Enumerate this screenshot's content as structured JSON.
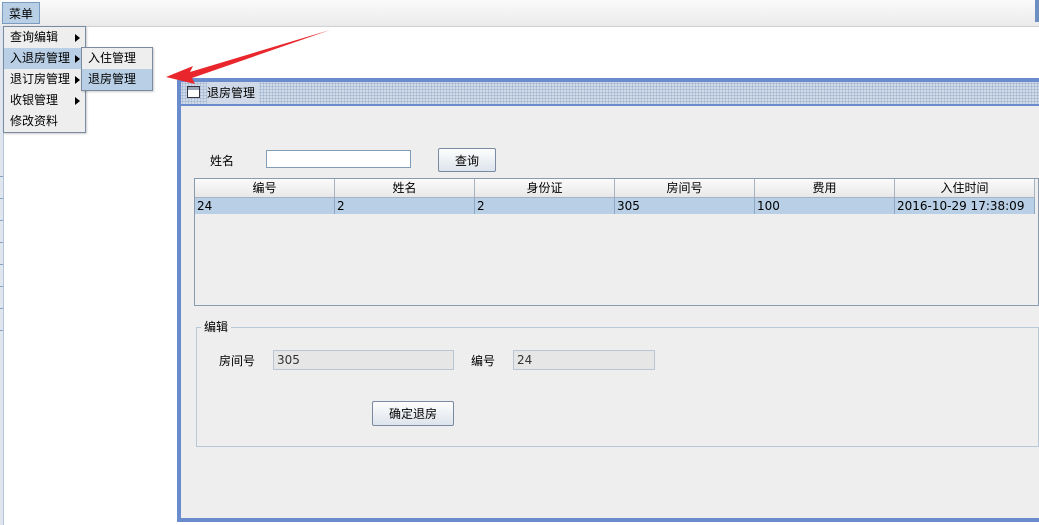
{
  "menubar": {
    "menu_title": "菜单"
  },
  "main_menu": {
    "items": [
      {
        "label": "查询编辑",
        "has_submenu": true
      },
      {
        "label": "入退房管理",
        "has_submenu": true
      },
      {
        "label": "退订房管理",
        "has_submenu": true
      },
      {
        "label": "收银管理",
        "has_submenu": true
      },
      {
        "label": "修改资料",
        "has_submenu": false
      }
    ]
  },
  "sub_menu": {
    "items": [
      {
        "label": "入住管理"
      },
      {
        "label": "退房管理"
      }
    ]
  },
  "window": {
    "title": "退房管理"
  },
  "search": {
    "name_label": "姓名",
    "name_value": "",
    "button_label": "查询"
  },
  "table": {
    "columns": [
      "编号",
      "姓名",
      "身份证",
      "房间号",
      "费用",
      "入住时间"
    ],
    "rows": [
      [
        "24",
        "2",
        "2",
        "305",
        "100",
        "2016-10-29 17:38:09"
      ]
    ]
  },
  "edit": {
    "group_title": "编辑",
    "room_label": "房间号",
    "room_value": "305",
    "id_label": "编号",
    "id_value": "24",
    "confirm_button": "确定退房"
  },
  "colors": {
    "selection": "#b8cfe5",
    "frame_border": "#6b8ccc",
    "annotation_arrow": "#e8262b"
  }
}
